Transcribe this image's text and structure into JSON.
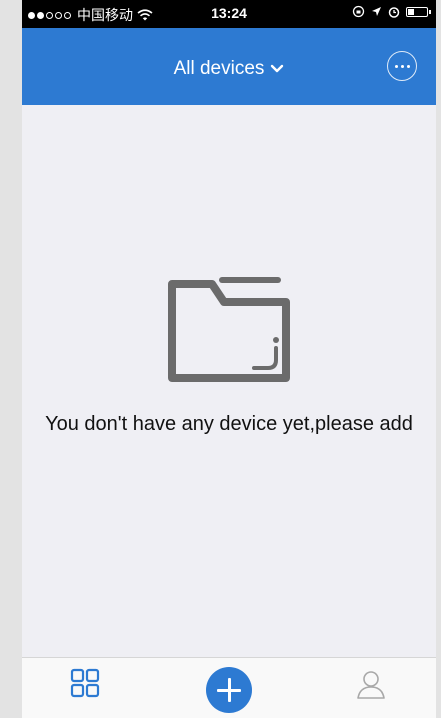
{
  "status_bar": {
    "carrier": "中国移动",
    "time": "13:24",
    "signal_icon": "signal-dots-icon",
    "wifi_icon": "wifi-icon",
    "battery_level": 0.35
  },
  "nav": {
    "title": "All devices",
    "title_icon": "chevron-down-icon",
    "more_icon": "more-options-icon"
  },
  "empty_state": {
    "icon": "folder-icon",
    "message": "You don't have any device yet,please add"
  },
  "tabbar": {
    "devices_icon": "grid-icon",
    "add_icon": "plus-icon",
    "user_icon": "user-icon"
  },
  "colors": {
    "accent": "#2d7ad2",
    "background": "#efeff4"
  }
}
